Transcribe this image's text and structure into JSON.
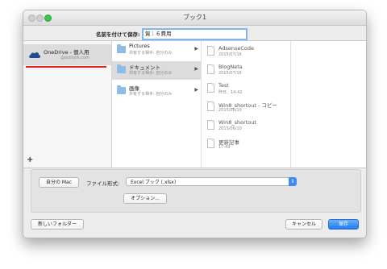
{
  "window": {
    "title": "ブック1"
  },
  "save": {
    "label": "名前を付けて保存:",
    "value": "賀｜６費用"
  },
  "sidebar": {
    "items": [
      {
        "name": "OneDrive - 個人用",
        "account": "@outlook.com"
      }
    ],
    "add_label": "+"
  },
  "folders": [
    {
      "name": "Pictures",
      "sub": "共有する相手: 自分のみ"
    },
    {
      "name": "ドキュメント",
      "sub": "共有する相手: 自分のみ"
    },
    {
      "name": "画像",
      "sub": "共有する相手: 自分のみ"
    }
  ],
  "files": [
    {
      "name": "AdsenseCode",
      "date": "2015/07/16"
    },
    {
      "name": "BlogNeta",
      "date": "2015/07/16"
    },
    {
      "name": "Test",
      "date": "昨日、14:42"
    },
    {
      "name": "Win8_shortout - コピー",
      "date": "2015/06/10"
    },
    {
      "name": "Win8_shortout",
      "date": "2015/06/10"
    },
    {
      "name": "更新記事",
      "date": "17:49"
    }
  ],
  "options": {
    "my_mac_label": "自分の Mac",
    "format_label": "ファイル形式:",
    "format_value": "Excel ブック (.xlsx)",
    "options_label": "オプション..."
  },
  "footer": {
    "new_folder_label": "新しいフォルダー",
    "cancel_label": "キャンセル",
    "save_label": "保存"
  },
  "colors": {
    "accent": "#1f79f0",
    "onedrive_underline": "#e2231a",
    "folder": "#8cbde9"
  }
}
